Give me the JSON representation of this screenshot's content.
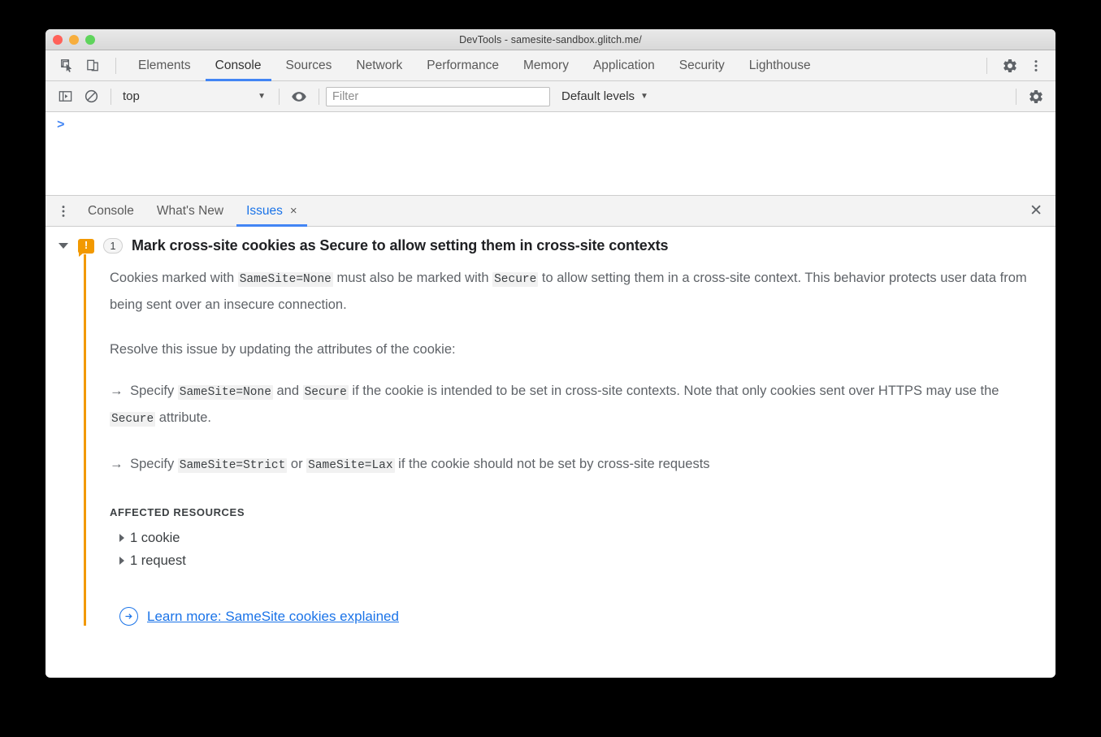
{
  "window": {
    "title": "DevTools - samesite-sandbox.glitch.me/"
  },
  "main_tabs": {
    "items": [
      {
        "label": "Elements",
        "selected": false
      },
      {
        "label": "Console",
        "selected": true
      },
      {
        "label": "Sources",
        "selected": false
      },
      {
        "label": "Network",
        "selected": false
      },
      {
        "label": "Performance",
        "selected": false
      },
      {
        "label": "Memory",
        "selected": false
      },
      {
        "label": "Application",
        "selected": false
      },
      {
        "label": "Security",
        "selected": false
      },
      {
        "label": "Lighthouse",
        "selected": false
      }
    ],
    "inspect_icon": "inspect-element-icon",
    "device_toolbar_icon": "device-toolbar-icon",
    "settings_icon": "gear-icon",
    "more_icon": "more-vertical-icon"
  },
  "console_toolbar": {
    "sidebar_toggle_icon": "console-sidebar-icon",
    "clear_icon": "clear-console-icon",
    "context": "top",
    "context_caret": "▼",
    "eye_icon": "live-expression-eye-icon",
    "filter_placeholder": "Filter",
    "filter_value": "",
    "levels_label": "Default levels",
    "levels_caret": "▼",
    "settings_icon": "gear-icon"
  },
  "console_output": {
    "prompt": ">"
  },
  "drawer": {
    "more_icon": "more-vertical-icon",
    "tabs": [
      {
        "label": "Console",
        "selected": false,
        "closable": false
      },
      {
        "label": "What's New",
        "selected": false,
        "closable": false
      },
      {
        "label": "Issues",
        "selected": true,
        "closable": true
      }
    ],
    "close_tab_glyph": "×",
    "close_drawer_glyph": "✕"
  },
  "issue": {
    "expand_icon": "expand-triangle-down-icon",
    "severity_icon": "warning-icon",
    "severity_glyph": "!",
    "severity_color": "#f29900",
    "count": "1",
    "title": "Mark cross-site cookies as Secure to allow setting them in cross-site contexts",
    "paragraph1": {
      "part1": "Cookies marked with ",
      "code1": "SameSite=None",
      "part2": " must also be marked with ",
      "code2": "Secure",
      "part3": " to allow setting them in a cross-site context. This behavior protects user data from being sent over an insecure connection."
    },
    "paragraph2": "Resolve this issue by updating the attributes of the cookie:",
    "bullet1": {
      "arrow": "→",
      "part1": " Specify ",
      "code1": "SameSite=None",
      "part2": " and ",
      "code2": "Secure",
      "part3": " if the cookie is intended to be set in cross-site contexts. Note that only cookies sent over HTTPS may use the ",
      "code3": "Secure",
      "part4": " attribute."
    },
    "bullet2": {
      "arrow": "→",
      "part1": " Specify ",
      "code1": "SameSite=Strict",
      "part2": " or ",
      "code2": "SameSite=Lax",
      "part3": " if the cookie should not be set by cross-site requests"
    },
    "affected_resources_label": "AFFECTED RESOURCES",
    "resources": [
      {
        "label": "1 cookie"
      },
      {
        "label": "1 request"
      }
    ],
    "learn_more": {
      "icon": "circled-arrow-right-icon",
      "label": "Learn more: SameSite cookies explained",
      "color": "#1a73e8"
    }
  }
}
